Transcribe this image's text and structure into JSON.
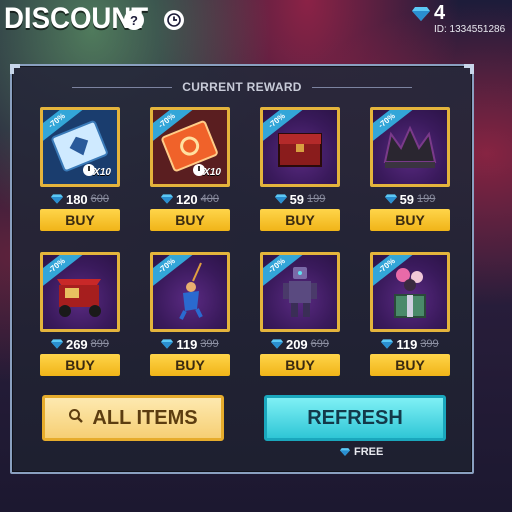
{
  "header": {
    "title": "DISCOUNT",
    "help_icon": "?",
    "gem_count": "4",
    "player_id": "ID: 1334551286"
  },
  "section_title": "CURRENT REWARD",
  "items": [
    {
      "badge": "-70%",
      "price": "180",
      "old_price": "600",
      "buy": "BUY",
      "multiplier": "X10",
      "icon": "voucher-ticket-icon"
    },
    {
      "badge": "-70%",
      "price": "120",
      "old_price": "400",
      "buy": "BUY",
      "multiplier": "X10",
      "icon": "voucher-ticket-orange-icon"
    },
    {
      "badge": "-70%",
      "price": "59",
      "old_price": "199",
      "buy": "BUY",
      "icon": "loot-crate-icon"
    },
    {
      "badge": "-70%",
      "price": "59",
      "old_price": "199",
      "buy": "BUY",
      "icon": "dark-crown-icon"
    },
    {
      "badge": "-70%",
      "price": "269",
      "old_price": "899",
      "buy": "BUY",
      "icon": "tuk-tuk-vehicle-icon"
    },
    {
      "badge": "-70%",
      "price": "119",
      "old_price": "399",
      "buy": "BUY",
      "icon": "skydiving-character-icon"
    },
    {
      "badge": "-70%",
      "price": "209",
      "old_price": "699",
      "buy": "BUY",
      "icon": "robot-character-icon"
    },
    {
      "badge": "-70%",
      "price": "119",
      "old_price": "399",
      "buy": "BUY",
      "icon": "jester-box-icon"
    }
  ],
  "buttons": {
    "all_items": "ALL ITEMS",
    "refresh": "REFRESH",
    "refresh_cost": "FREE"
  },
  "colors": {
    "gold": "#e4b43c",
    "cyan": "#2fc6d6",
    "badge_blue": "#33a6d8",
    "diamond": "#4fb8f0"
  }
}
